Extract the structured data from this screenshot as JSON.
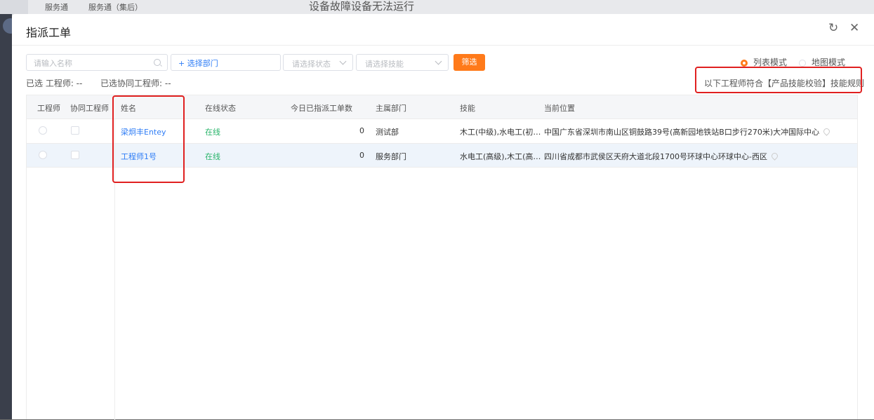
{
  "background": {
    "tab1": "服务通",
    "tab2": "服务通（集后）",
    "title": "设备故障设备无法运行"
  },
  "modal": {
    "title": "指派工单",
    "refresh_icon": "refresh-icon",
    "close_icon": "close-icon"
  },
  "filters": {
    "name_placeholder": "请输入名称",
    "dept_button": "+ 选择部门",
    "status_placeholder": "请选择状态",
    "skill_placeholder": "请选择技能",
    "filter_button": "筛选"
  },
  "view_mode": {
    "list": "列表模式",
    "map": "地图模式",
    "selected": "list"
  },
  "selected_info": {
    "engineer": "已选 工程师: --",
    "assist": "已选协同工程师: --"
  },
  "rule_text": "以下工程师符合【产品技能校验】技能规则",
  "table": {
    "headers": {
      "engineer": "工程师",
      "assist": "协同工程师",
      "name": "姓名",
      "online": "在线状态",
      "count": "今日已指派工单数",
      "dept": "主属部门",
      "skill": "技能",
      "location": "当前位置"
    },
    "rows": [
      {
        "name": "梁炯丰Entey",
        "online": "在线",
        "count": "0",
        "dept": "测试部",
        "skill": "木工(中级),水电工(初…",
        "location": "中国广东省深圳市南山区铜鼓路39号(高新园地铁站B口步行270米)大冲国际中心"
      },
      {
        "name": "工程师1号",
        "online": "在线",
        "count": "0",
        "dept": "服务部门",
        "skill": "水电工(高级),木工(高…",
        "location": "四川省成都市武侯区天府大道北段1700号环球中心环球中心-西区"
      }
    ]
  },
  "colors": {
    "accent": "#ff7a1a",
    "link": "#2f7df6",
    "online": "#28b46a",
    "annotation": "#e02020"
  }
}
